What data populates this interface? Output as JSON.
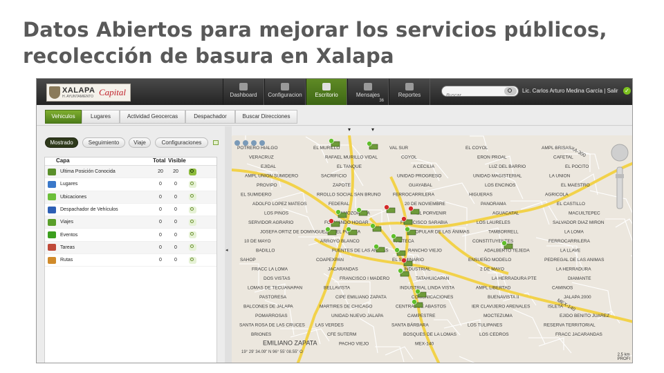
{
  "slide": {
    "title_line1": "Datos Abiertos para mejorar los servicios públicos,",
    "title_line2": "recolección de basura en Xalapa"
  },
  "logo": {
    "name": "XALAPA",
    "sub": "H. AYUNTAMIENTO",
    "capital": "Capital"
  },
  "nav": [
    {
      "label": "Dashboard",
      "icon": "dashboard-icon",
      "active": false
    },
    {
      "label": "Configuracion",
      "icon": "settings-icon",
      "active": false
    },
    {
      "label": "Escritorio",
      "icon": "desktop-icon",
      "active": true
    },
    {
      "label": "Mensajes",
      "icon": "envelope-icon",
      "active": false,
      "badge": "36"
    },
    {
      "label": "Reportes",
      "icon": "report-icon",
      "active": false
    }
  ],
  "search": {
    "placeholder": "Buscar..."
  },
  "user": {
    "text": "Lic. Carlos Arturo Medina García  |  Salir"
  },
  "tabs": [
    "Vehiculos",
    "Lugares",
    "Actividad Geocercas",
    "Despachador",
    "Buscar Direcciones"
  ],
  "pills": [
    "Mostrado",
    "Seguimiento",
    "Viaje",
    "Configuraciones"
  ],
  "table": {
    "headers": {
      "layer": "Capa",
      "total": "Total",
      "visible": "Visible"
    },
    "rows": [
      {
        "name": "Ultima Posición Conocida",
        "total": "20",
        "visible": "20",
        "icon": "truck-icon",
        "color": "#5a8f2a",
        "active": true
      },
      {
        "name": "Lugares",
        "total": "0",
        "visible": "0",
        "icon": "places-icon",
        "color": "#3a78c9",
        "active": false
      },
      {
        "name": "Ubicaciones",
        "total": "0",
        "visible": "0",
        "icon": "location-icon",
        "color": "#6cbf3a",
        "active": false
      },
      {
        "name": "Despachador de Vehículos",
        "total": "0",
        "visible": "0",
        "icon": "dispatch-icon",
        "color": "#2d5fb5",
        "active": false
      },
      {
        "name": "Viajes",
        "total": "0",
        "visible": "0",
        "icon": "flag-icon",
        "color": "#5a9f2a",
        "active": false
      },
      {
        "name": "Eventos",
        "total": "0",
        "visible": "0",
        "icon": "play-icon",
        "color": "#3c9f1e",
        "active": false
      },
      {
        "name": "Tareas",
        "total": "0",
        "visible": "0",
        "icon": "megaphone-icon",
        "color": "#c04a3a",
        "active": false
      },
      {
        "name": "Rutas",
        "total": "0",
        "visible": "0",
        "icon": "routes-icon",
        "color": "#d08a2a",
        "active": false
      }
    ]
  },
  "map": {
    "labels": [
      "POTRERO HIALGO",
      "EL MURILLO",
      "VAL SUR",
      "EL COYOL",
      "AMPL BRISAS",
      "VERACRUZ",
      "RAFAEL MURILLO VIDAL",
      "COYOL",
      "ERON PROAL",
      "CAFETAL",
      "EJIDAL",
      "EL TANQUE",
      "A CECILIA",
      "LUZ DEL BARRIO",
      "EL POCITO",
      "AMPL UNION SUMIDERO",
      "SACRIFICIO",
      "UNIDAD PROGRESO",
      "UNIDAD MAGISTERIAL",
      "LA UNION",
      "PROVIPO",
      "ZAPOTE",
      "GUAYABAL",
      "LOS ENCINOS",
      "EL MAESTRO",
      "EL SUMIDERO",
      "RROLLO SOCIAL SAN BRUNO",
      "FERROCARRILERA",
      "HIGUERAS",
      "AGRICOLA",
      "ADOLFO LOPEZ MATEOS",
      "FEDERAL",
      "20 DE NOVIEMBRE",
      "PANORAMA",
      "EL CASTILLO",
      "LOS PINOS",
      "AMOZORRITA",
      "EL PORVENIR",
      "AGUACATAL",
      "MACUILTEPEC",
      "SERVIDOR AGRARIO",
      "FORMANDO HOGAR",
      "FRANCISCO SARABIA",
      "LOS LAURELES",
      "SALVADOR DIAZ MIRON",
      "JOSEFA ORTIZ DE DOMINGUEZ",
      "EL POLICIA",
      "POPULAR DE LAS ÁNIMAS",
      "TAMBORRELL",
      "LA LOMA",
      "10 DE MAYO",
      "ARROYO BLANCO",
      "AZTECA",
      "CONSTITUYENTES",
      "FERROCARRILERA",
      "BADILLO",
      "FUENTES DE LAS ANIMAS",
      "RANCHO VIEJO",
      "ADALBERTO TEJEDA",
      "LA LLAVE",
      "SAHOP",
      "COAPEXPAN",
      "EL SEMINARIO",
      "ENSUEÑO MODELO",
      "PEDREGAL DE LAS ANIMAS",
      "FRACC LA LOMA",
      "JACARANDAS",
      "INDUSTRIAL",
      "2 DE MAYO",
      "LA HERRADURA",
      "DOS VISTAS",
      "FRANCISCO I MADERO",
      "TATAHUICAPAN",
      "LA HERRADURA PTE",
      "DIAMANTE",
      "LOMAS DE TECUANAPAN",
      "BELLAVISTA",
      "INDUSTRIAL LINDA VISTA",
      "AMPL LIBERTAD",
      "CAMINOS",
      "PASTORESA",
      "CIPE EMILIANO ZAPATA",
      "COMUNICACIONES",
      "BUENAVISTA II",
      "JALAPA 2000",
      "BALCONES DE JALAPA",
      "MARTIRES DE CHICAGO",
      "CENTRAL DE ABASTOS",
      "IER CLAVIJERO ARENALES",
      "ISLETA",
      "POMARROSAS",
      "UNIDAD NUEVO JALAPA",
      "CAMPESTRE",
      "MOCTEZUMA",
      "EJIDO BENITO JUAREZ",
      "SANTA ROSA DE LAS CRUCES",
      "LAS VERDES",
      "SANTA BÁRBARA",
      "LOS TULIPANES",
      "RESERVA TERRITORIAL",
      "BRIONES",
      "CFE SUTERM",
      "BOSQUES DE LA LOMAS",
      "LOS CEDROS",
      "FRACC JACARANDAS",
      "EMILIANO ZAPATA",
      "PACHO VIEJO",
      "MEX-140"
    ],
    "coords": "19° 29' 34.09\" N 96° 55' 08.55\" O",
    "scale": "2.5 km",
    "scale_extra": "PROFI",
    "highway_label": "MEX-140",
    "road_label": "XA-300"
  }
}
